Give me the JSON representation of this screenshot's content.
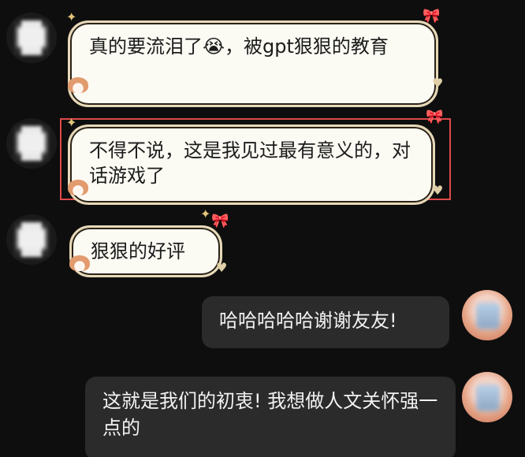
{
  "messages": [
    {
      "side": "left",
      "text": "真的要流泪了😭，被gpt狠狠的教育"
    },
    {
      "side": "left",
      "text": "不得不说，这是我见过最有意义的，对话游戏了",
      "highlighted": true
    },
    {
      "side": "left",
      "text": "狠狠的好评"
    },
    {
      "side": "right",
      "text": "哈哈哈哈哈谢谢友友!"
    },
    {
      "side": "right",
      "text": "这就是我们的初衷! 我想做人文关怀强一点的"
    }
  ],
  "highlight_color": "#e04a4a",
  "bubble_colors": {
    "left": "#fbfaf3",
    "right": "#2b2b2b"
  }
}
